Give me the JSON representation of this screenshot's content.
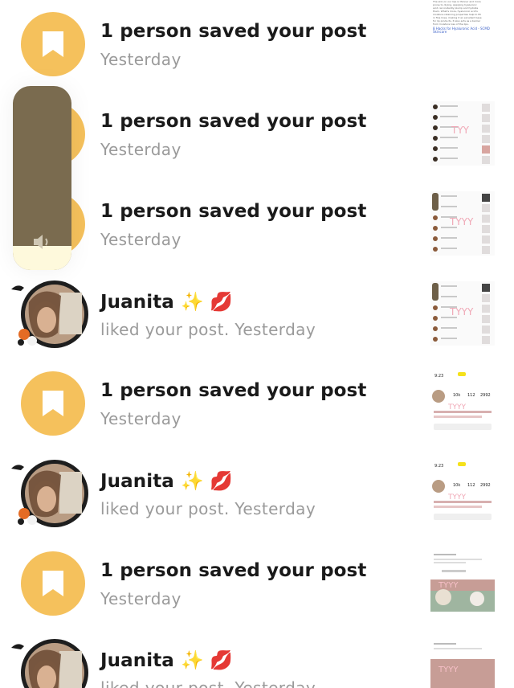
{
  "notifications": [
    {
      "type": "saved",
      "title": "1 person saved your post",
      "sub": "Yesterday",
      "thumb": {
        "lines": [
          "The skin on our lips is thinner and more",
          "prone to drying. Applying hyaluronic",
          "acid can instantly plump and hydrate",
          "them. What's more, hyaluronic acid's",
          "moisture-retaining properties help to fill",
          "in fine lines, making it an excellent base",
          "for lip products. It also acts as a barrier",
          "from moisture loss of the lips."
        ],
        "link": "8 Hacks for Hyaluronic Acid - SCMD Skincare"
      }
    },
    {
      "type": "saved",
      "title": "1 person saved your post",
      "sub": "Yesterday"
    },
    {
      "type": "saved",
      "title": "1 person saved your post",
      "sub": "Yesterday"
    },
    {
      "type": "liked",
      "name": "Juanita",
      "emojis": "✨ 💋",
      "sub": "liked your post. Yesterday"
    },
    {
      "type": "saved",
      "title": "1 person saved your post",
      "sub": "Yesterday",
      "thumb": {
        "time": "9:23",
        "stats": [
          "10k",
          "112",
          "2992"
        ]
      }
    },
    {
      "type": "liked",
      "name": "Juanita",
      "emojis": "✨ 💋",
      "sub": "liked your post. Yesterday"
    },
    {
      "type": "saved",
      "title": "1 person saved your post",
      "sub": "Yesterday"
    },
    {
      "type": "liked",
      "name": "Juanita",
      "emojis": "✨ 💋",
      "sub": "liked your post. Yesterday"
    }
  ],
  "volume_hud": {
    "level": 0.13,
    "icon": "speaker-icon"
  },
  "colors": {
    "saved_avatar": "#f5c15c",
    "title": "#1a1a1a",
    "subtitle": "#9a9a9a",
    "hud": "#7a6b4f",
    "hud_fill": "#fef9dc"
  },
  "icons": {
    "saved": "bookmark-icon",
    "speaker": "speaker-icon"
  }
}
